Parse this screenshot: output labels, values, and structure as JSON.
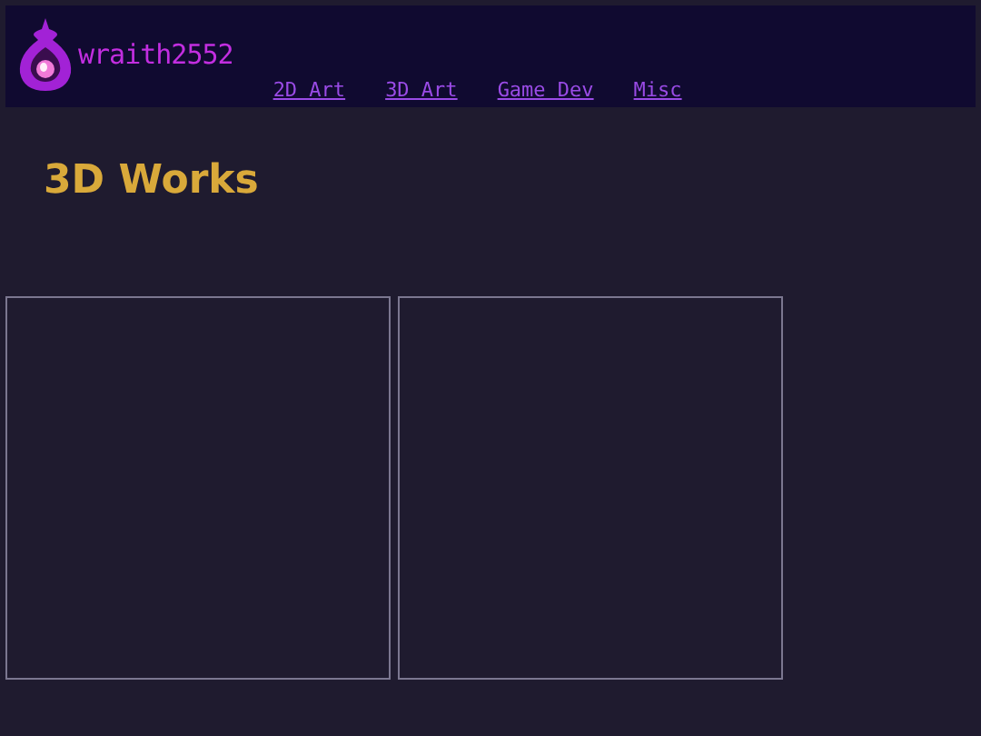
{
  "header": {
    "logo_text": "wraith2552",
    "nav": [
      {
        "label": "2D Art"
      },
      {
        "label": "3D Art"
      },
      {
        "label": "Game Dev"
      },
      {
        "label": "Misc"
      }
    ]
  },
  "page_title": "3D Works",
  "gallery": [
    {
      "kind": "frame"
    },
    {
      "kind": "frame"
    }
  ]
}
